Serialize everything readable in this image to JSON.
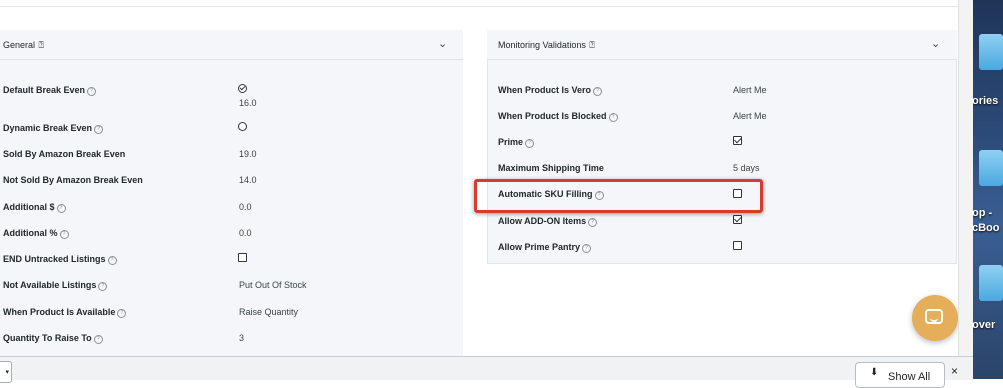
{
  "general": {
    "title": "General",
    "help_icon": "question-circle-icon",
    "rows": [
      {
        "label": "Default Break Even",
        "help": true,
        "value": "16.0",
        "control": "radio-checked"
      },
      {
        "label": "Dynamic Break Even",
        "help": true,
        "value": "",
        "control": "radio-unchecked"
      },
      {
        "label": "Sold By Amazon Break Even",
        "help": false,
        "value": "19.0"
      },
      {
        "label": "Not Sold By Amazon Break Even",
        "help": false,
        "value": "14.0"
      },
      {
        "label": "Additional $",
        "help": true,
        "value": "0.0"
      },
      {
        "label": "Additional %",
        "help": true,
        "value": "0.0"
      },
      {
        "label": "END Untracked Listings",
        "help": true,
        "value": "",
        "control": "checkbox-unchecked"
      },
      {
        "label": "Not Available Listings",
        "help": true,
        "value": "Put Out Of Stock"
      },
      {
        "label": "When Product Is Available",
        "help": true,
        "value": "Raise Quantity"
      },
      {
        "label": "Quantity To Raise To",
        "help": true,
        "value": "3"
      }
    ]
  },
  "monitoring": {
    "title": "Monitoring Validations",
    "rows": [
      {
        "label": "When Product Is Vero",
        "help": true,
        "value": "Alert Me"
      },
      {
        "label": "When Product Is Blocked",
        "help": true,
        "value": "Alert Me"
      },
      {
        "label": "Prime",
        "help": true,
        "control": "checkbox-checked"
      },
      {
        "label": "Maximum Shipping Time",
        "help": false,
        "value": "5 days"
      },
      {
        "label": "Automatic SKU Filling",
        "help": true,
        "control": "checkbox-unchecked",
        "highlighted": true
      },
      {
        "label": "Allow ADD-ON Items",
        "help": true,
        "control": "checkbox-checked"
      },
      {
        "label": "Allow Prime Pantry",
        "help": true,
        "control": "checkbox-unchecked"
      }
    ]
  },
  "highlight_color": "#d73b2f",
  "bottom_bar": {
    "select_arrow": "▾",
    "show_all_label": "Show All",
    "download_icon": "download-arrow-icon",
    "close_label": "×"
  },
  "chat_button": {
    "icon": "chat-bubble-icon",
    "color": "#e5ae5a"
  },
  "desktop": {
    "labels": [
      "ories",
      "op -",
      "cBoo",
      "over"
    ]
  }
}
